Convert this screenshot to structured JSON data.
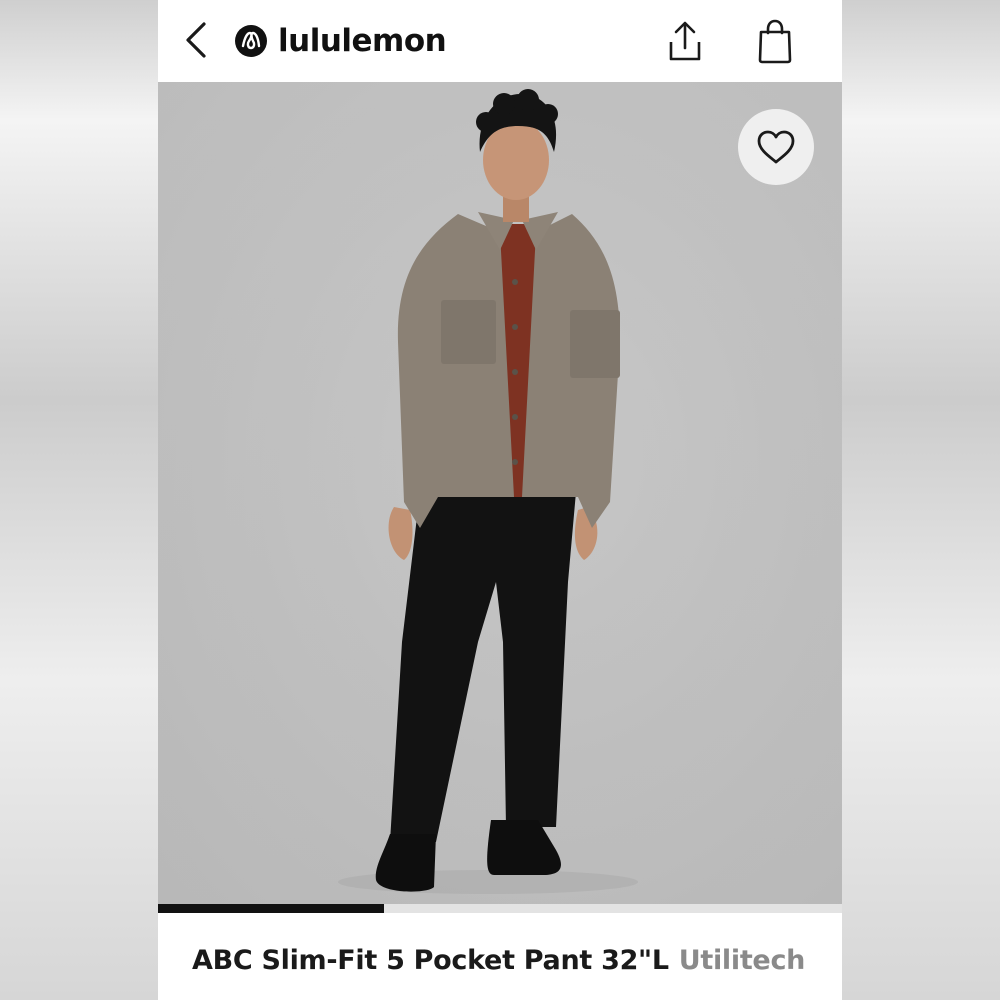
{
  "header": {
    "brand": "lululemon",
    "icons": {
      "back": "chevron-left-icon",
      "logo": "lululemon-logo-icon",
      "share": "share-icon",
      "bag": "shopping-bag-icon"
    }
  },
  "product": {
    "image_description_icon": "product-photo",
    "favorite_icon": "heart-icon",
    "image_progress_fraction": 0.33,
    "title": "ABC Slim-Fit 5 Pocket Pant 32\"L",
    "fabric": "Utilitech"
  },
  "colors": {
    "background": "#ffffff",
    "text_primary": "#1a1a1a",
    "text_secondary": "#8a8a8a",
    "progress_active": "#111111",
    "progress_track": "#e3e3e3"
  }
}
